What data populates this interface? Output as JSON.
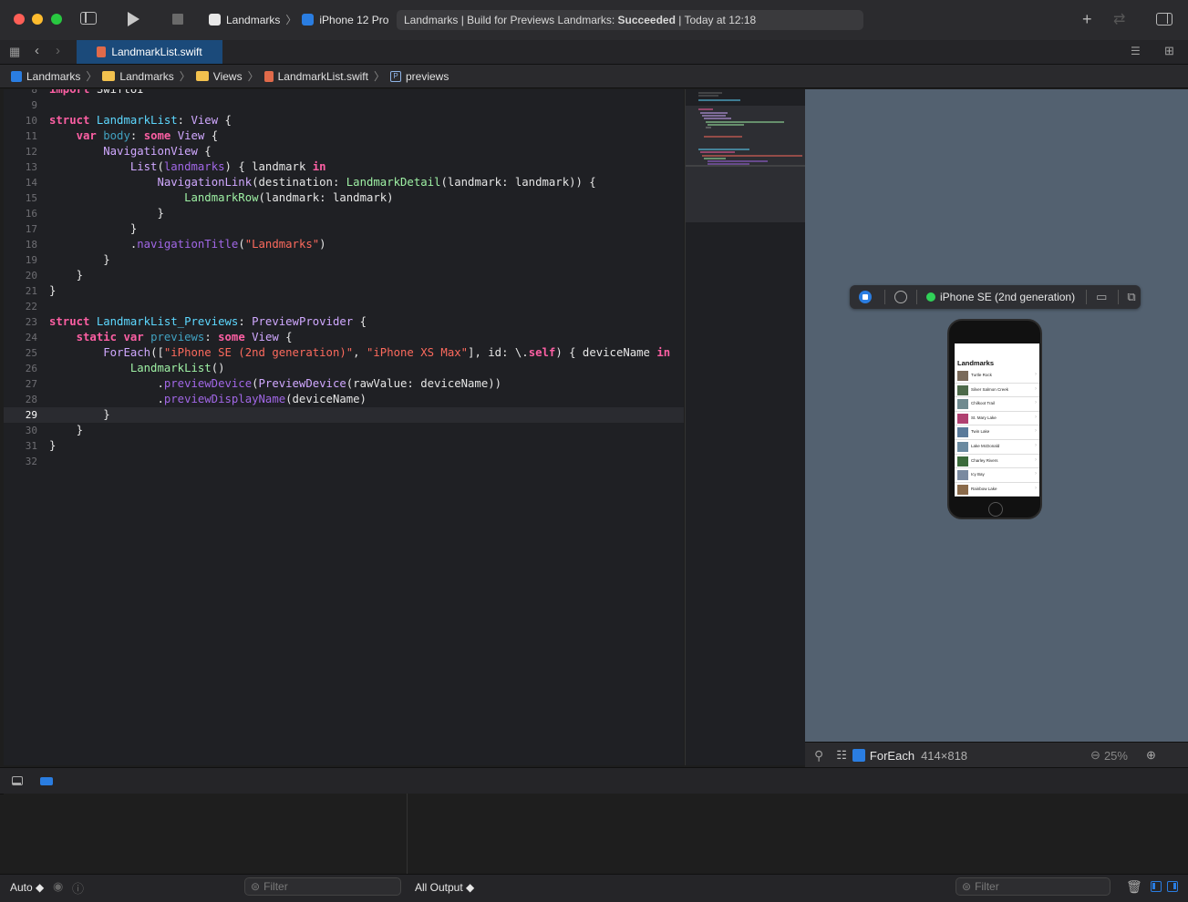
{
  "toolbar": {
    "scheme": "Landmarks",
    "destination": "iPhone 12 Pro",
    "activity_prefix": "Landmarks | Build for Previews Landmarks: ",
    "activity_status": "Succeeded",
    "activity_time": "| Today at 12:18"
  },
  "tabs": [
    {
      "label": "LandmarkList.swift",
      "active": true
    }
  ],
  "jumpbar": {
    "items": [
      "Landmarks",
      "Landmarks",
      "Views",
      "LandmarkList.swift",
      "previews"
    ]
  },
  "editor": {
    "current_line": 29,
    "lines": [
      {
        "n": "8",
        "partial": "import SwiftUI"
      },
      {
        "n": "9"
      },
      {
        "n": "10"
      },
      {
        "n": "11"
      },
      {
        "n": "12"
      },
      {
        "n": "13"
      },
      {
        "n": "14"
      },
      {
        "n": "15"
      },
      {
        "n": "16"
      },
      {
        "n": "17"
      },
      {
        "n": "18"
      },
      {
        "n": "19"
      },
      {
        "n": "20"
      },
      {
        "n": "21"
      },
      {
        "n": "22"
      },
      {
        "n": "23"
      },
      {
        "n": "24"
      },
      {
        "n": "25"
      },
      {
        "n": "26"
      },
      {
        "n": "27"
      },
      {
        "n": "28"
      },
      {
        "n": "29"
      },
      {
        "n": "30"
      },
      {
        "n": "31"
      },
      {
        "n": "32"
      }
    ],
    "strings": {
      "nav_title": "\"Landmarks\"",
      "device_se": "\"iPhone SE (2nd generation)\"",
      "device_max": "\"iPhone XS Max\""
    }
  },
  "preview": {
    "device_label": "iPhone SE (2nd generation)",
    "screen_title": "Landmarks",
    "rows": [
      "Turtle Rock",
      "Silver Salmon Creek",
      "Chilkoot Trail",
      "St. Mary Lake",
      "Twin Lake",
      "Lake McDonald",
      "Charley Rivers",
      "Icy Bay",
      "Rainbow Lake"
    ],
    "thumb_colors": [
      "#7a6a5a",
      "#4d6a4a",
      "#6f8a8f",
      "#b04070",
      "#5a7a9a",
      "#6a8aa0",
      "#3a6a3a",
      "#7a8aa0",
      "#8a6a4a"
    ]
  },
  "canvas_bar": {
    "view_name": "ForEach",
    "view_size": "414×818",
    "zoom": "25%"
  },
  "bottom": {
    "auto_label": "Auto ◆",
    "filter_placeholder": "Filter",
    "output_label": "All Output ◆",
    "filter2_placeholder": "Filter"
  },
  "colors": {
    "accent": "#1b4a7a",
    "keyword": "#fc5fa3",
    "string": "#fc6a5d",
    "type": "#d0a8ff",
    "success_dot": "#30d158"
  }
}
